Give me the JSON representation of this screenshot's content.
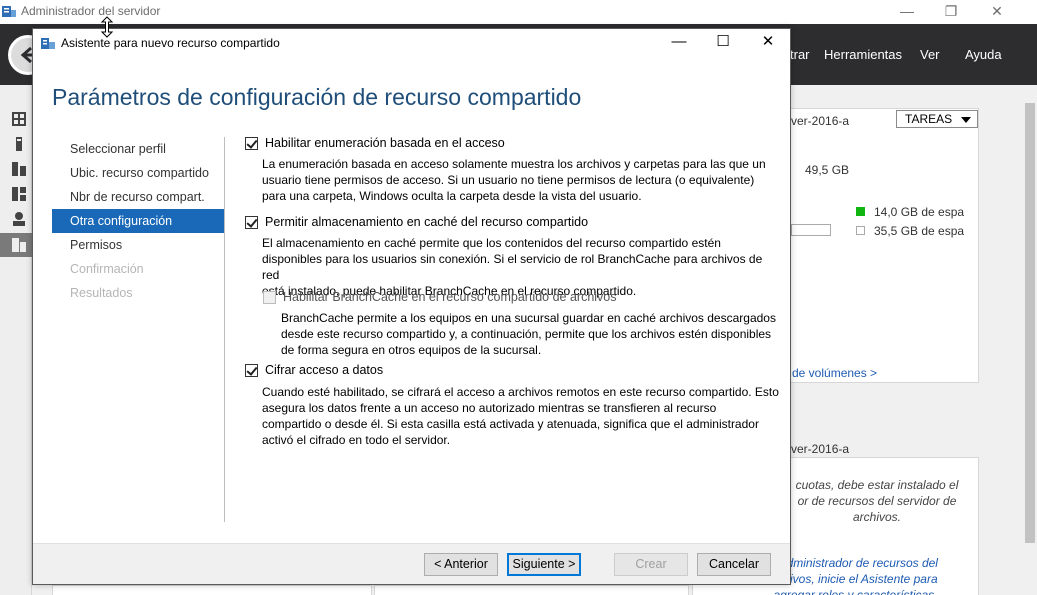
{
  "background_window": {
    "title": "Administrador del servidor",
    "window_controls": {
      "minimize": "—",
      "maximize": "❐",
      "close": "✕"
    },
    "menu": [
      "trar",
      "Herramientas",
      "Ver",
      "Ayuda"
    ],
    "server_label_1": "ver-2016-a",
    "tasks_label": "TAREAS",
    "capacity": "49,5 GB",
    "legend": [
      {
        "label": "14,0 GB de espac",
        "color": "#10b510"
      },
      {
        "label": "35,5 GB de espac",
        "color": "#ffffff"
      }
    ],
    "volumes_link": "de volúmenes >",
    "server_label_2": "ver-2016-a",
    "info_text": [
      "cuotas, debe estar instalado el",
      "or de recursos del servidor de",
      "archivos."
    ],
    "info_link": [
      "l Administrador de recursos del",
      "rchivos, inicie el Asistente para",
      "agregar roles y características."
    ]
  },
  "dialog": {
    "title": "Asistente para nuevo recurso compartido",
    "window_controls": {
      "minimize": "—",
      "maximize": "☐",
      "close": "✕"
    },
    "heading": "Parámetros de configuración de recurso compartido",
    "nav": [
      {
        "label": "Seleccionar perfil",
        "state": "normal"
      },
      {
        "label": "Ubic. recurso compartido",
        "state": "normal"
      },
      {
        "label": "Nbr de recurso compart.",
        "state": "normal"
      },
      {
        "label": "Otra configuración",
        "state": "active"
      },
      {
        "label": "Permisos",
        "state": "normal"
      },
      {
        "label": "Confirmación",
        "state": "disabled"
      },
      {
        "label": "Resultados",
        "state": "disabled"
      }
    ],
    "options": {
      "abe": {
        "label": "Habilitar enumeración basada en el acceso",
        "checked": true,
        "description": [
          "La enumeración basada en acceso solamente muestra los archivos y carpetas para las que un",
          "usuario tiene permisos de acceso. Si un usuario no tiene permisos de lectura (o equivalente)",
          "para una carpeta, Windows oculta la carpeta desde la vista del usuario."
        ]
      },
      "caching": {
        "label": "Permitir almacenamiento en caché del recurso compartido",
        "checked": true,
        "description": [
          "El almacenamiento en caché permite que los contenidos del recurso compartido estén",
          "disponibles para los usuarios sin conexión. Si el servicio de rol BranchCache para archivos de red",
          "está instalado, puede habilitar BranchCache en el recurso compartido."
        ]
      },
      "branchcache": {
        "label": "Habilitar BranchCache en el recurso compartido de archivos",
        "checked": false,
        "enabled": false,
        "description": [
          "BranchCache permite a los equipos en una sucursal guardar en caché archivos descargados",
          "desde este recurso compartido y, a continuación, permite que los archivos estén disponibles",
          "de forma segura en otros equipos de la sucursal."
        ]
      },
      "encrypt": {
        "label": "Cifrar acceso a datos",
        "checked": true,
        "description": [
          "Cuando esté habilitado, se cifrará el acceso a archivos remotos en este recurso compartido. Esto",
          "asegura los datos frente a un acceso no autorizado mientras se transfieren al recurso",
          "compartido o desde él. Si esta casilla está activada y atenuada, significa que el administrador",
          "activó el cifrado en todo el servidor."
        ]
      }
    },
    "buttons": {
      "back": "< Anterior",
      "next": "Siguiente >",
      "create": "Crear",
      "cancel": "Cancelar"
    }
  },
  "colors": {
    "heading": "#1e4e79",
    "nav_active_bg": "#1a69b8",
    "header_bg": "#2d2d30",
    "link": "#1e5bb2"
  }
}
